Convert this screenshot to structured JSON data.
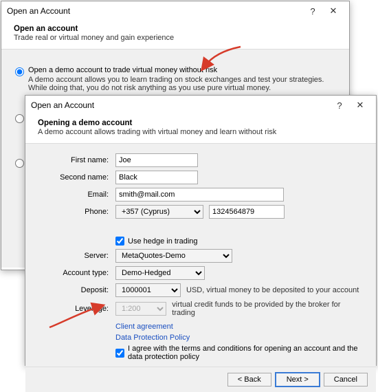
{
  "dialog1": {
    "title": "Open an Account",
    "help_icon": "?",
    "close_icon": "✕",
    "header_title": "Open an account",
    "header_sub": "Trade real or virtual money and gain experience",
    "radio_demo_label": "Open a demo account to trade virtual money without risk",
    "radio_demo_desc": "A demo account allows you to learn trading on stock exchanges and test your strategies. While doing that, you do not risk anything as you use pure virtual money."
  },
  "dialog2": {
    "title": "Open an Account",
    "help_icon": "?",
    "close_icon": "✕",
    "header_title": "Opening a demo account",
    "header_sub": "A demo account allows trading with virtual money and learn without risk",
    "labels": {
      "first_name": "First name:",
      "second_name": "Second name:",
      "email": "Email:",
      "phone": "Phone:",
      "use_hedge": "Use hedge in trading",
      "server": "Server:",
      "account_type": "Account type:",
      "deposit": "Deposit:",
      "deposit_hint": "USD, virtual money to be deposited to your account",
      "leverage": "Leverage:",
      "leverage_hint": "virtual credit funds to be provided by the broker for trading",
      "link_client": "Client agreement",
      "link_dpp": "Data Protection Policy",
      "agree": "I agree with the terms and conditions for opening an account and the data protection policy",
      "btn_back": "< Back",
      "btn_next": "Next >",
      "btn_cancel": "Cancel"
    },
    "values": {
      "first_name": "Joe",
      "second_name": "Black",
      "email": "smith@mail.com",
      "phone_code": "+357 (Cyprus)",
      "phone_num": "1324564879",
      "server": "MetaQuotes-Demo",
      "account_type": "Demo-Hedged",
      "deposit": "1000001",
      "leverage": "1:200"
    }
  }
}
